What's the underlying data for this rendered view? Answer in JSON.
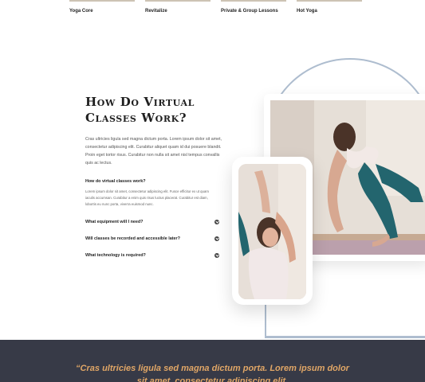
{
  "class_strip": {
    "items": [
      {
        "label": "Yoga Core"
      },
      {
        "label": "Revitalize"
      },
      {
        "label": "Private & Group Lessons"
      },
      {
        "label": "Hot Yoga"
      }
    ]
  },
  "section": {
    "title_line1": "How Do Virtual",
    "title_line2": "Classes Work?",
    "intro": "Cras ultricies ligula sed magna dictum porta. Lorem ipsum dolor sit amet, consectetur adipiscing elit. Curabitur aliquet quam id dui posuere blandit. Proin eget tortor risus. Curabitur non nulla sit amet nisl tempus convallis quis ac lectus."
  },
  "faq": {
    "open": {
      "question": "How do virtual classes work?",
      "answer": "Lorem ipsum dolor sit amet, consectetur adipiscing elit. Fusce efficitur ex ut quam iaculis accumsan. Curabitur a enim quis risus luctus placerat. Curabitur est diam, lobortis eu nunc porta, viverra euismod nunc."
    },
    "items": [
      {
        "question": "What equipment will I need?"
      },
      {
        "question": "Will classes be recorded and accessible later?"
      },
      {
        "question": "What technology is required?"
      }
    ]
  },
  "quote": {
    "text": "“Cras ultricies ligula sed magna dictum porta. Lorem ipsum dolor sit amet, consectetur adipiscing elit."
  },
  "colors": {
    "accent_blue": "#aebdcf",
    "dark_band": "#373a47",
    "quote_gold": "#e0a666"
  }
}
